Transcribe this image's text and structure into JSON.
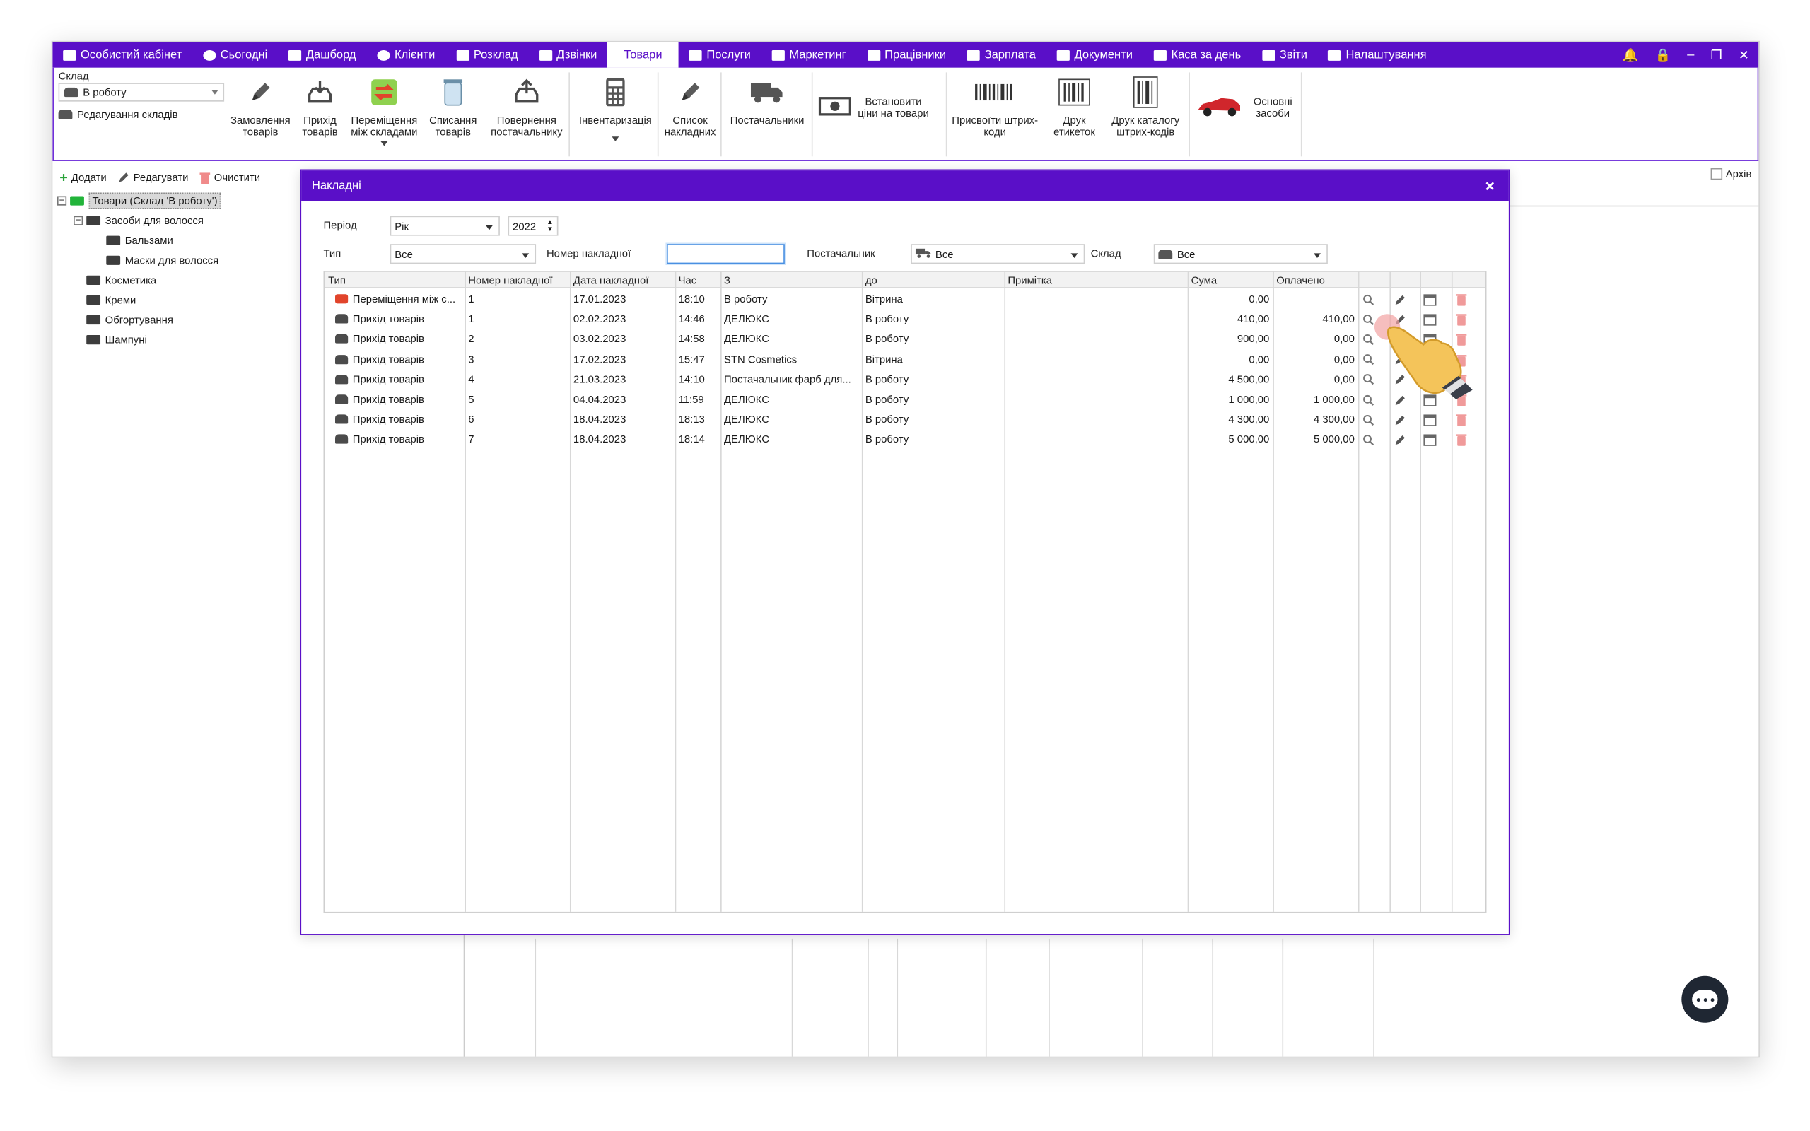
{
  "menu": {
    "items": [
      {
        "label": "Особистий кабінет",
        "icon": "wallet-icon"
      },
      {
        "label": "Сьогодні",
        "icon": "clock-icon"
      },
      {
        "label": "Дашборд",
        "icon": "pulse-icon"
      },
      {
        "label": "Клієнти",
        "icon": "user-circle-icon"
      },
      {
        "label": "Розклад",
        "icon": "calendar-icon"
      },
      {
        "label": "Дзвінки",
        "icon": "phone-icon"
      },
      {
        "label": "Товари",
        "icon": "box-icon",
        "active": true
      },
      {
        "label": "Послуги",
        "icon": "bolt-icon"
      },
      {
        "label": "Маркетинг",
        "icon": "megaphone-icon"
      },
      {
        "label": "Працівники",
        "icon": "person-icon"
      },
      {
        "label": "Зарплата",
        "icon": "money-icon"
      },
      {
        "label": "Документи",
        "icon": "document-icon"
      },
      {
        "label": "Каса за день",
        "icon": "calculator-icon"
      },
      {
        "label": "Звіти",
        "icon": "bar-chart-icon"
      },
      {
        "label": "Налаштування",
        "icon": "gear-icon"
      }
    ],
    "window_icons": [
      "bell-icon",
      "lock-icon",
      "minimize-icon",
      "restore-icon",
      "close-icon"
    ]
  },
  "ribbon": {
    "warehouse_label": "Склад",
    "warehouse_value": "В роботу",
    "edit_warehouses": "Редагування складів",
    "buttons": {
      "order": "Замовлення товарів",
      "receipt": "Прихід товарів",
      "move": "Переміщення між складами",
      "writeoff": "Списання товарів",
      "return": "Повернення постачальнику",
      "inventory": "Інвентаризація",
      "invoices": "Список накладних",
      "suppliers": "Постачальники",
      "set_prices": "Встановити ціни на товари",
      "assign_barcodes": "Присвоїти штрих-коди",
      "print_labels": "Друк етикеток",
      "print_catalog": "Друк каталогу штрих-кодів",
      "fixed_assets": "Основні засоби"
    }
  },
  "toolbar": {
    "add": "Додати",
    "edit": "Редагувати",
    "clear": "Очистити",
    "archive": "Архів"
  },
  "tree": {
    "root": "Товари (Склад 'В роботу')",
    "items": [
      {
        "label": "Засоби для волосся",
        "level": 1
      },
      {
        "label": "Бальзами",
        "level": 2
      },
      {
        "label": "Маски для волосся",
        "level": 2
      },
      {
        "label": "Косметика",
        "level": 1
      },
      {
        "label": "Креми",
        "level": 1
      },
      {
        "label": "Обгортування",
        "level": 1
      },
      {
        "label": "Шампуні",
        "level": 1
      }
    ]
  },
  "dialog": {
    "title": "Накладні",
    "filters": {
      "period_label": "Період",
      "period_value": "Рік",
      "year_value": "2022",
      "type_label": "Тип",
      "type_value": "Все",
      "invoice_number_label": "Номер накладної",
      "invoice_number_value": "",
      "supplier_label": "Постачальник",
      "supplier_value": "Все",
      "warehouse_label": "Склад",
      "warehouse_value": "Все"
    },
    "columns": [
      "Тип",
      "Номер накладної",
      "Дата накладної",
      "Час",
      "З",
      "до",
      "Примітка",
      "Сума",
      "Оплачено"
    ],
    "rows": [
      {
        "type": "Переміщення між с...",
        "kind": "move",
        "number": "1",
        "date": "17.01.2023",
        "time": "18:10",
        "from": "В роботу",
        "to": "Вітрина",
        "note": "",
        "sum": "0,00",
        "paid": ""
      },
      {
        "type": "Прихід товарів",
        "kind": "receipt",
        "number": "1",
        "date": "02.02.2023",
        "time": "14:46",
        "from": "ДЕЛЮКС",
        "to": "В роботу",
        "note": "",
        "sum": "410,00",
        "paid": "410,00"
      },
      {
        "type": "Прихід товарів",
        "kind": "receipt",
        "number": "2",
        "date": "03.02.2023",
        "time": "14:58",
        "from": "ДЕЛЮКС",
        "to": "В роботу",
        "note": "",
        "sum": "900,00",
        "paid": "0,00"
      },
      {
        "type": "Прихід товарів",
        "kind": "receipt",
        "number": "3",
        "date": "17.02.2023",
        "time": "15:47",
        "from": "STN Cosmetics",
        "to": "Вітрина",
        "note": "",
        "sum": "0,00",
        "paid": "0,00"
      },
      {
        "type": "Прихід товарів",
        "kind": "receipt",
        "number": "4",
        "date": "21.03.2023",
        "time": "14:10",
        "from": "Постачальник фарб для...",
        "to": "В роботу",
        "note": "",
        "sum": "4 500,00",
        "paid": "0,00"
      },
      {
        "type": "Прихід товарів",
        "kind": "receipt",
        "number": "5",
        "date": "04.04.2023",
        "time": "11:59",
        "from": "ДЕЛЮКС",
        "to": "В роботу",
        "note": "",
        "sum": "1 000,00",
        "paid": "1 000,00"
      },
      {
        "type": "Прихід товарів",
        "kind": "receipt",
        "number": "6",
        "date": "18.04.2023",
        "time": "18:13",
        "from": "ДЕЛЮКС",
        "to": "В роботу",
        "note": "",
        "sum": "4 300,00",
        "paid": "4 300,00"
      },
      {
        "type": "Прихід товарів",
        "kind": "receipt",
        "number": "7",
        "date": "18.04.2023",
        "time": "18:14",
        "from": "ДЕЛЮКС",
        "to": "В роботу",
        "note": "",
        "sum": "5 000,00",
        "paid": "5 000,00"
      }
    ],
    "row_actions": [
      "view-icon",
      "edit-icon",
      "print-icon",
      "delete-icon"
    ]
  },
  "colors": {
    "accent": "#5a0fc8",
    "delete": "#e96a6a",
    "tree_root": "#22b43a"
  }
}
